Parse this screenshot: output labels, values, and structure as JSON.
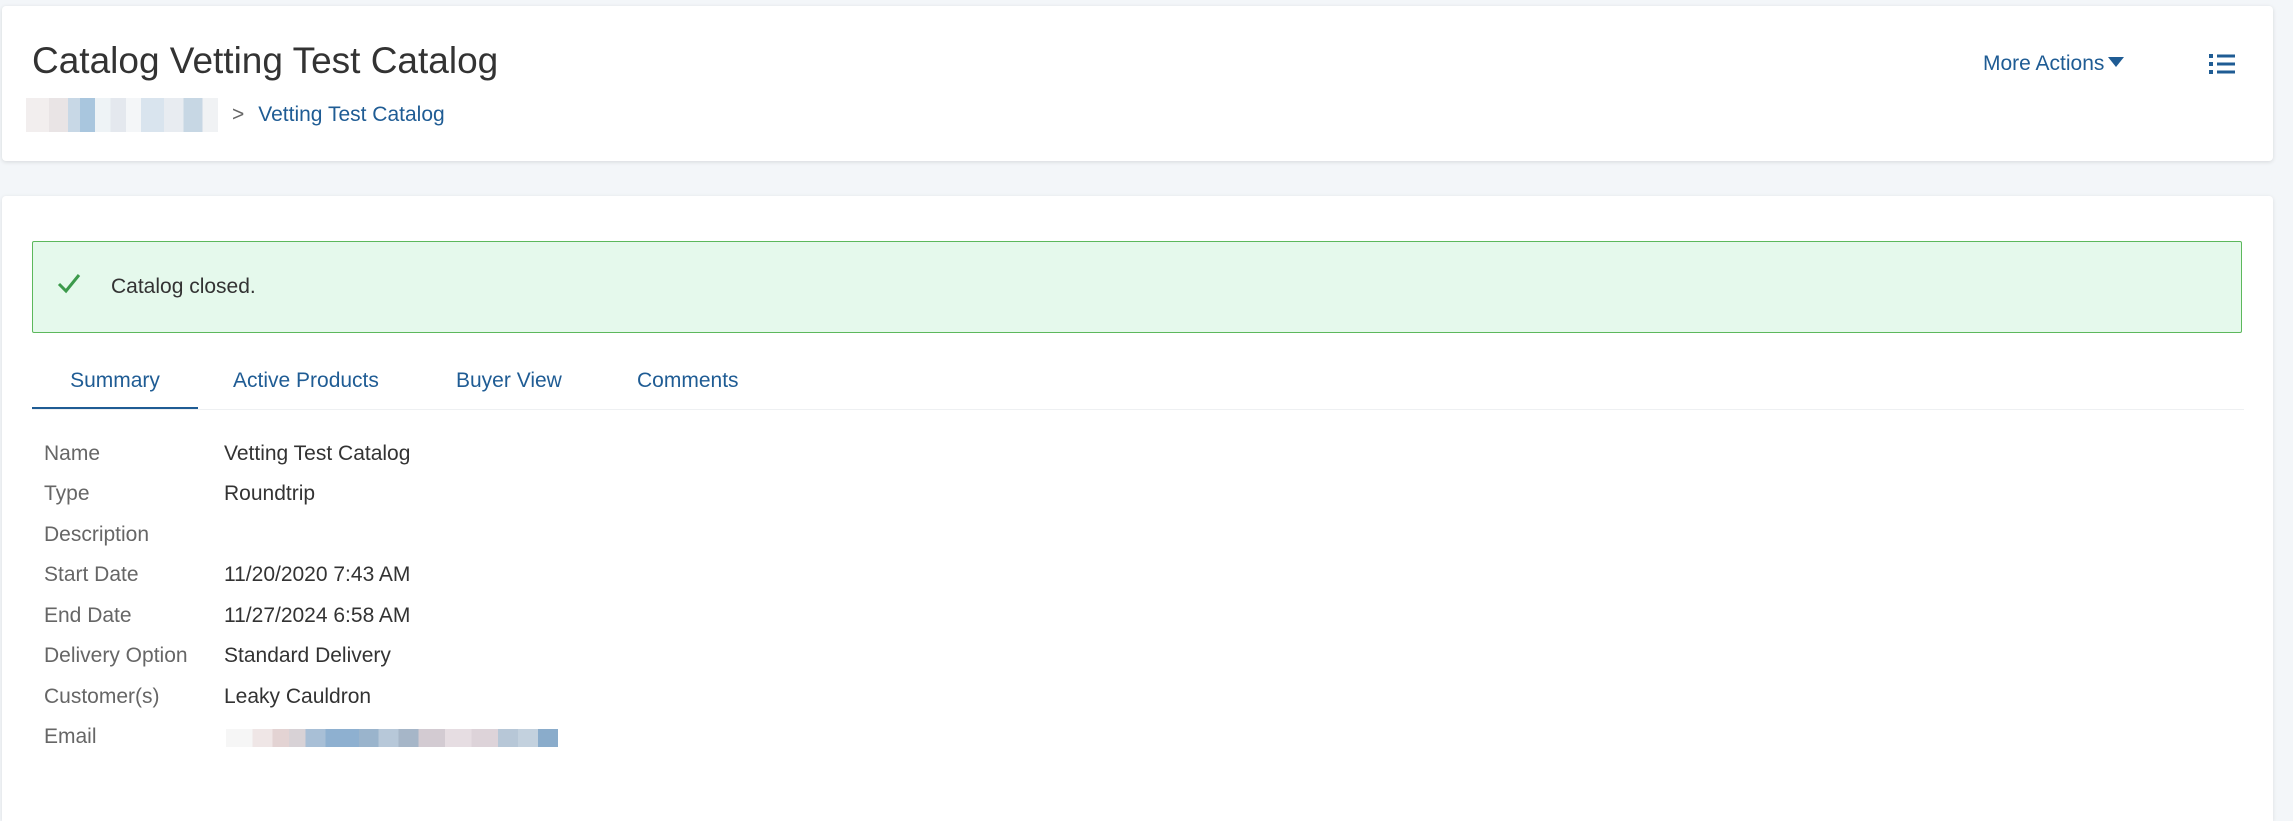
{
  "header": {
    "title": "Catalog Vetting Test Catalog",
    "breadcrumb": {
      "separator": ">",
      "current": "Vetting Test Catalog"
    },
    "more_actions_label": "More Actions"
  },
  "alert": {
    "type": "success",
    "message": "Catalog closed.",
    "color": "#5cb85c"
  },
  "tabs": [
    {
      "label": "Summary",
      "active": true
    },
    {
      "label": "Active Products",
      "active": false
    },
    {
      "label": "Buyer View",
      "active": false
    },
    {
      "label": "Comments",
      "active": false
    }
  ],
  "summary": {
    "fields": [
      {
        "label": "Name",
        "value": "Vetting Test Catalog"
      },
      {
        "label": "Type",
        "value": "Roundtrip"
      },
      {
        "label": "Description",
        "value": ""
      },
      {
        "label": "Start Date",
        "value": "11/20/2020 7:43 AM"
      },
      {
        "label": "End Date",
        "value": "11/27/2024 6:58 AM"
      },
      {
        "label": "Delivery Option",
        "value": "Standard Delivery"
      },
      {
        "label": "Customer(s)",
        "value": "Leaky Cauldron"
      },
      {
        "label": "Email",
        "value": ""
      }
    ]
  },
  "colors": {
    "link": "#1f5c94",
    "alert_bg": "#e5f9ec",
    "page_bg": "#f3f6f9"
  }
}
